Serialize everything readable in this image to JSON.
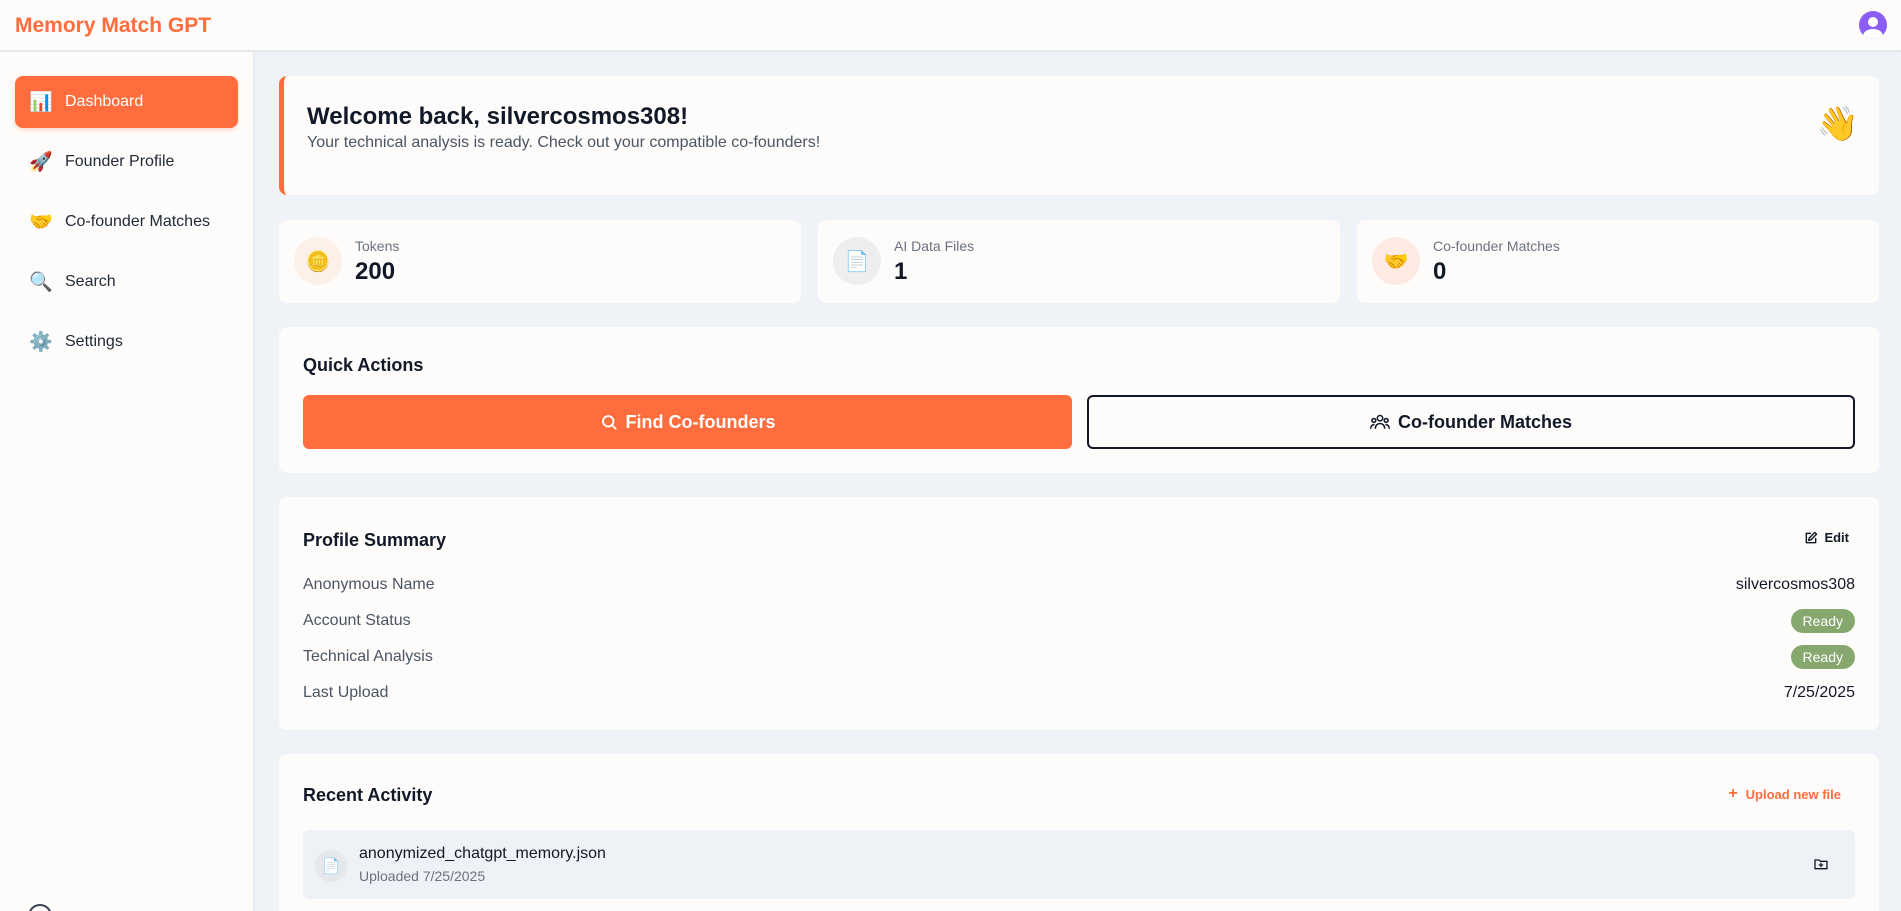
{
  "app": {
    "title": "Memory Match GPT"
  },
  "sidebar": {
    "items": [
      {
        "label": "Dashboard",
        "icon": "📊",
        "active": true
      },
      {
        "label": "Founder Profile",
        "icon": "🚀"
      },
      {
        "label": "Co-founder Matches",
        "icon": "🤝"
      },
      {
        "label": "Search",
        "icon": "🔍"
      },
      {
        "label": "Settings",
        "icon": "⚙️"
      }
    ]
  },
  "welcome": {
    "title": "Welcome back, silvercosmos308!",
    "subtitle": "Your technical analysis is ready. Check out your compatible co-founders!",
    "emoji": "👋"
  },
  "stats": [
    {
      "label": "Tokens",
      "value": "200",
      "icon": "🪙"
    },
    {
      "label": "AI Data Files",
      "value": "1",
      "icon": "📄"
    },
    {
      "label": "Co-founder Matches",
      "value": "0",
      "icon": "🤝"
    }
  ],
  "quick_actions": {
    "title": "Quick Actions",
    "primary_label": "Find Co-founders",
    "secondary_label": "Co-founder Matches"
  },
  "profile_summary": {
    "title": "Profile Summary",
    "edit_label": "Edit",
    "rows": [
      {
        "label": "Anonymous Name",
        "value": "silvercosmos308"
      },
      {
        "label": "Account Status",
        "value": "Ready"
      },
      {
        "label": "Technical Analysis",
        "value": "Ready"
      },
      {
        "label": "Last Upload",
        "value": "7/25/2025"
      }
    ]
  },
  "recent_activity": {
    "title": "Recent Activity",
    "upload_label": "Upload new file",
    "items": [
      {
        "name": "anonymized_chatgpt_memory.json",
        "date": "Uploaded 7/25/2025",
        "icon": "📄"
      }
    ]
  },
  "colors": {
    "accent": "#ff6c3d",
    "badge": "#86a86e",
    "avatar": "#8b5cf6"
  }
}
